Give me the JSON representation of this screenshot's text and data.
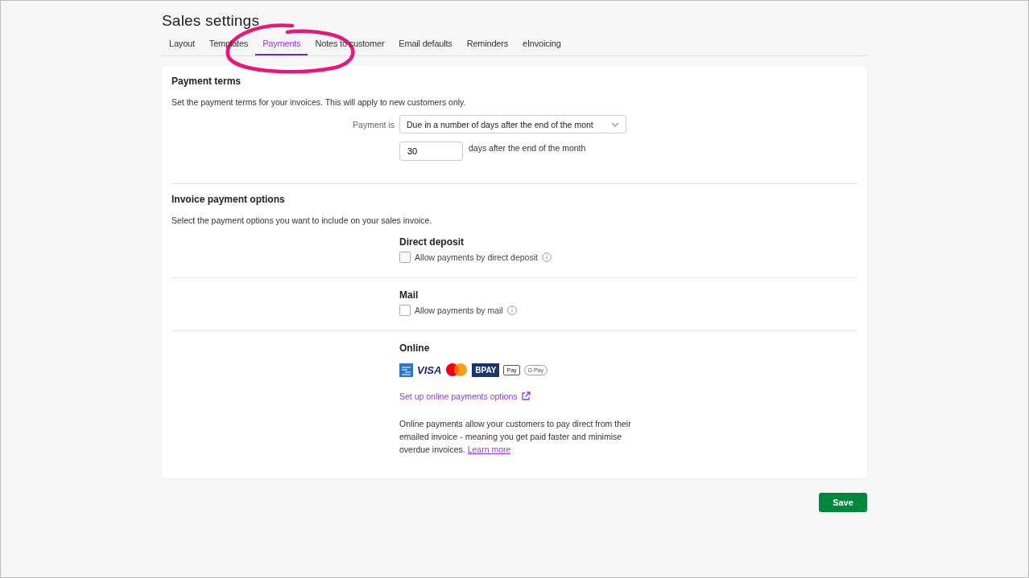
{
  "page": {
    "title": "Sales settings"
  },
  "tabs": [
    {
      "label": "Layout",
      "selected": false
    },
    {
      "label": "Templates",
      "selected": false
    },
    {
      "label": "Payments",
      "selected": true
    },
    {
      "label": "Notes to customer",
      "selected": false
    },
    {
      "label": "Email defaults",
      "selected": false
    },
    {
      "label": "Reminders",
      "selected": false
    },
    {
      "label": "eInvoicing",
      "selected": false
    }
  ],
  "payment_terms": {
    "heading": "Payment terms",
    "description": "Set the payment terms for your invoices. This will apply to new customers only.",
    "payment_label": "Payment is",
    "payment_value": "Due in a number of days after the end of the mont",
    "days_value": "30",
    "days_suffix": "days after the end of the month"
  },
  "invoice_payment_options": {
    "heading": "Invoice payment options",
    "description": "Select the payment options you want to include on your sales invoice.",
    "options": [
      {
        "title": "Direct deposit",
        "label": "Allow payments by direct deposit",
        "checked": false
      },
      {
        "title": "Mail",
        "label": "Allow payments by mail",
        "checked": false
      }
    ],
    "online": {
      "title": "Online",
      "logos": [
        {
          "kind": "amex"
        },
        {
          "kind": "visa",
          "label": "VISA"
        },
        {
          "kind": "mastercard"
        },
        {
          "kind": "bpay",
          "label": "BPAY"
        },
        {
          "kind": "applepay",
          "label": "Pay"
        },
        {
          "kind": "googlepay",
          "label": "G Pay"
        }
      ],
      "setup_link": "Set up online payments options",
      "text": "Online payments allow your customers to pay direct from their emailed invoice - meaning you get paid faster and minimise overdue invoices.",
      "learn_more": "Learn more"
    }
  },
  "save_button": "Save"
}
